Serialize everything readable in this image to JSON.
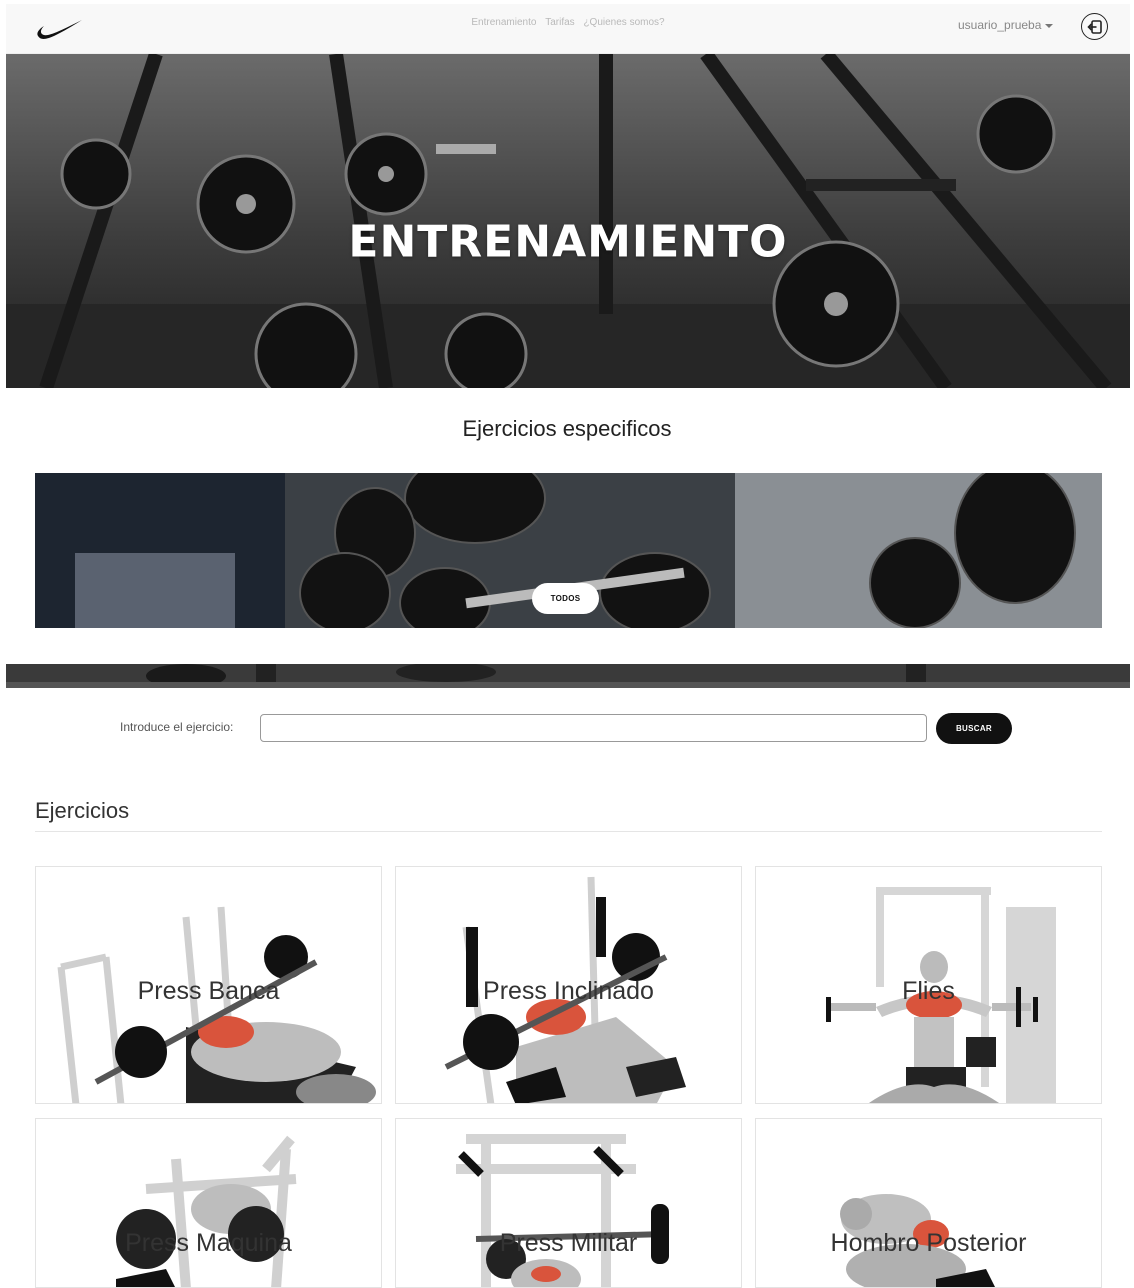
{
  "navbar": {
    "links": [
      "Entrenamiento",
      "Tarifas",
      "¿Quienes somos?"
    ],
    "username": "usuario_prueba"
  },
  "hero": {
    "title": "ENTRENAMIENTO"
  },
  "specific": {
    "title": "Ejercicios especificos",
    "todos_label": "TODOS"
  },
  "search": {
    "label": "Introduce el ejercicio:",
    "value": "",
    "placeholder": "",
    "button_label": "BUSCAR"
  },
  "exercises": {
    "heading": "Ejercicios",
    "items": [
      {
        "label": "Press Banca"
      },
      {
        "label": "Press Inclinado"
      },
      {
        "label": "Flies"
      },
      {
        "label": "Press Maquina"
      },
      {
        "label": "Press Militar"
      },
      {
        "label": "Hombro Posterior"
      }
    ]
  },
  "colors": {
    "nav_bg": "#f8f8f8",
    "button_dark": "#111111",
    "muscle_highlight": "#d9543c"
  }
}
